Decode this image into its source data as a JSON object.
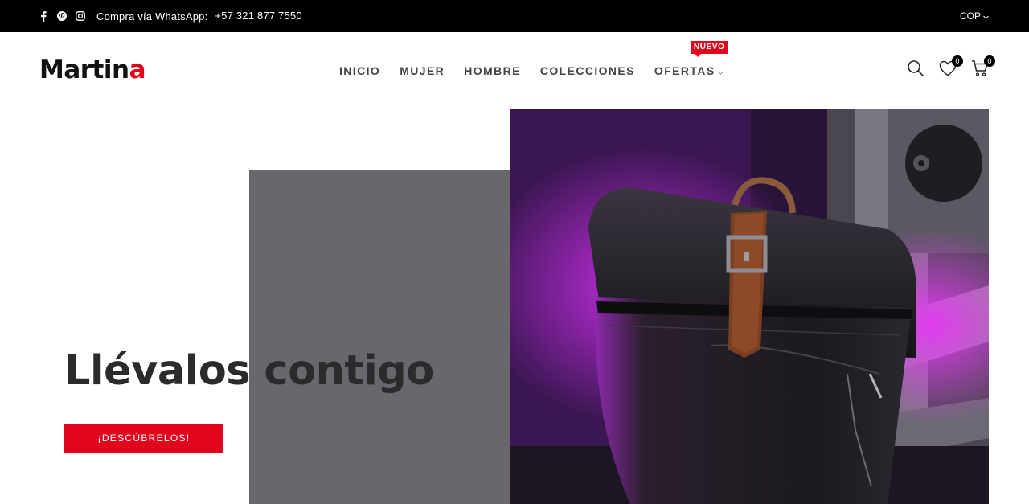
{
  "topbar": {
    "social_icons": [
      "facebook-icon",
      "pinterest-icon",
      "instagram-icon"
    ],
    "whatsapp_label": "Compra vía WhatsApp:",
    "whatsapp_phone": "+57 321 877 7550",
    "currency": "COP"
  },
  "header": {
    "logo_main": "Martin",
    "logo_accent": "a",
    "nav": [
      {
        "label": "INICIO"
      },
      {
        "label": "MUJER"
      },
      {
        "label": "HOMBRE"
      },
      {
        "label": "COLECCIONES"
      },
      {
        "label": "OFERTAS",
        "badge": "NUEVO"
      }
    ],
    "wishlist_count": "0",
    "cart_count": "0"
  },
  "hero": {
    "title": "Llévalos contigo",
    "cta_label": "¡DESCÚBRELOS!"
  },
  "colors": {
    "accent": "#e0051c",
    "topbar_bg": "#000000",
    "block_gray": "#6a666d"
  }
}
